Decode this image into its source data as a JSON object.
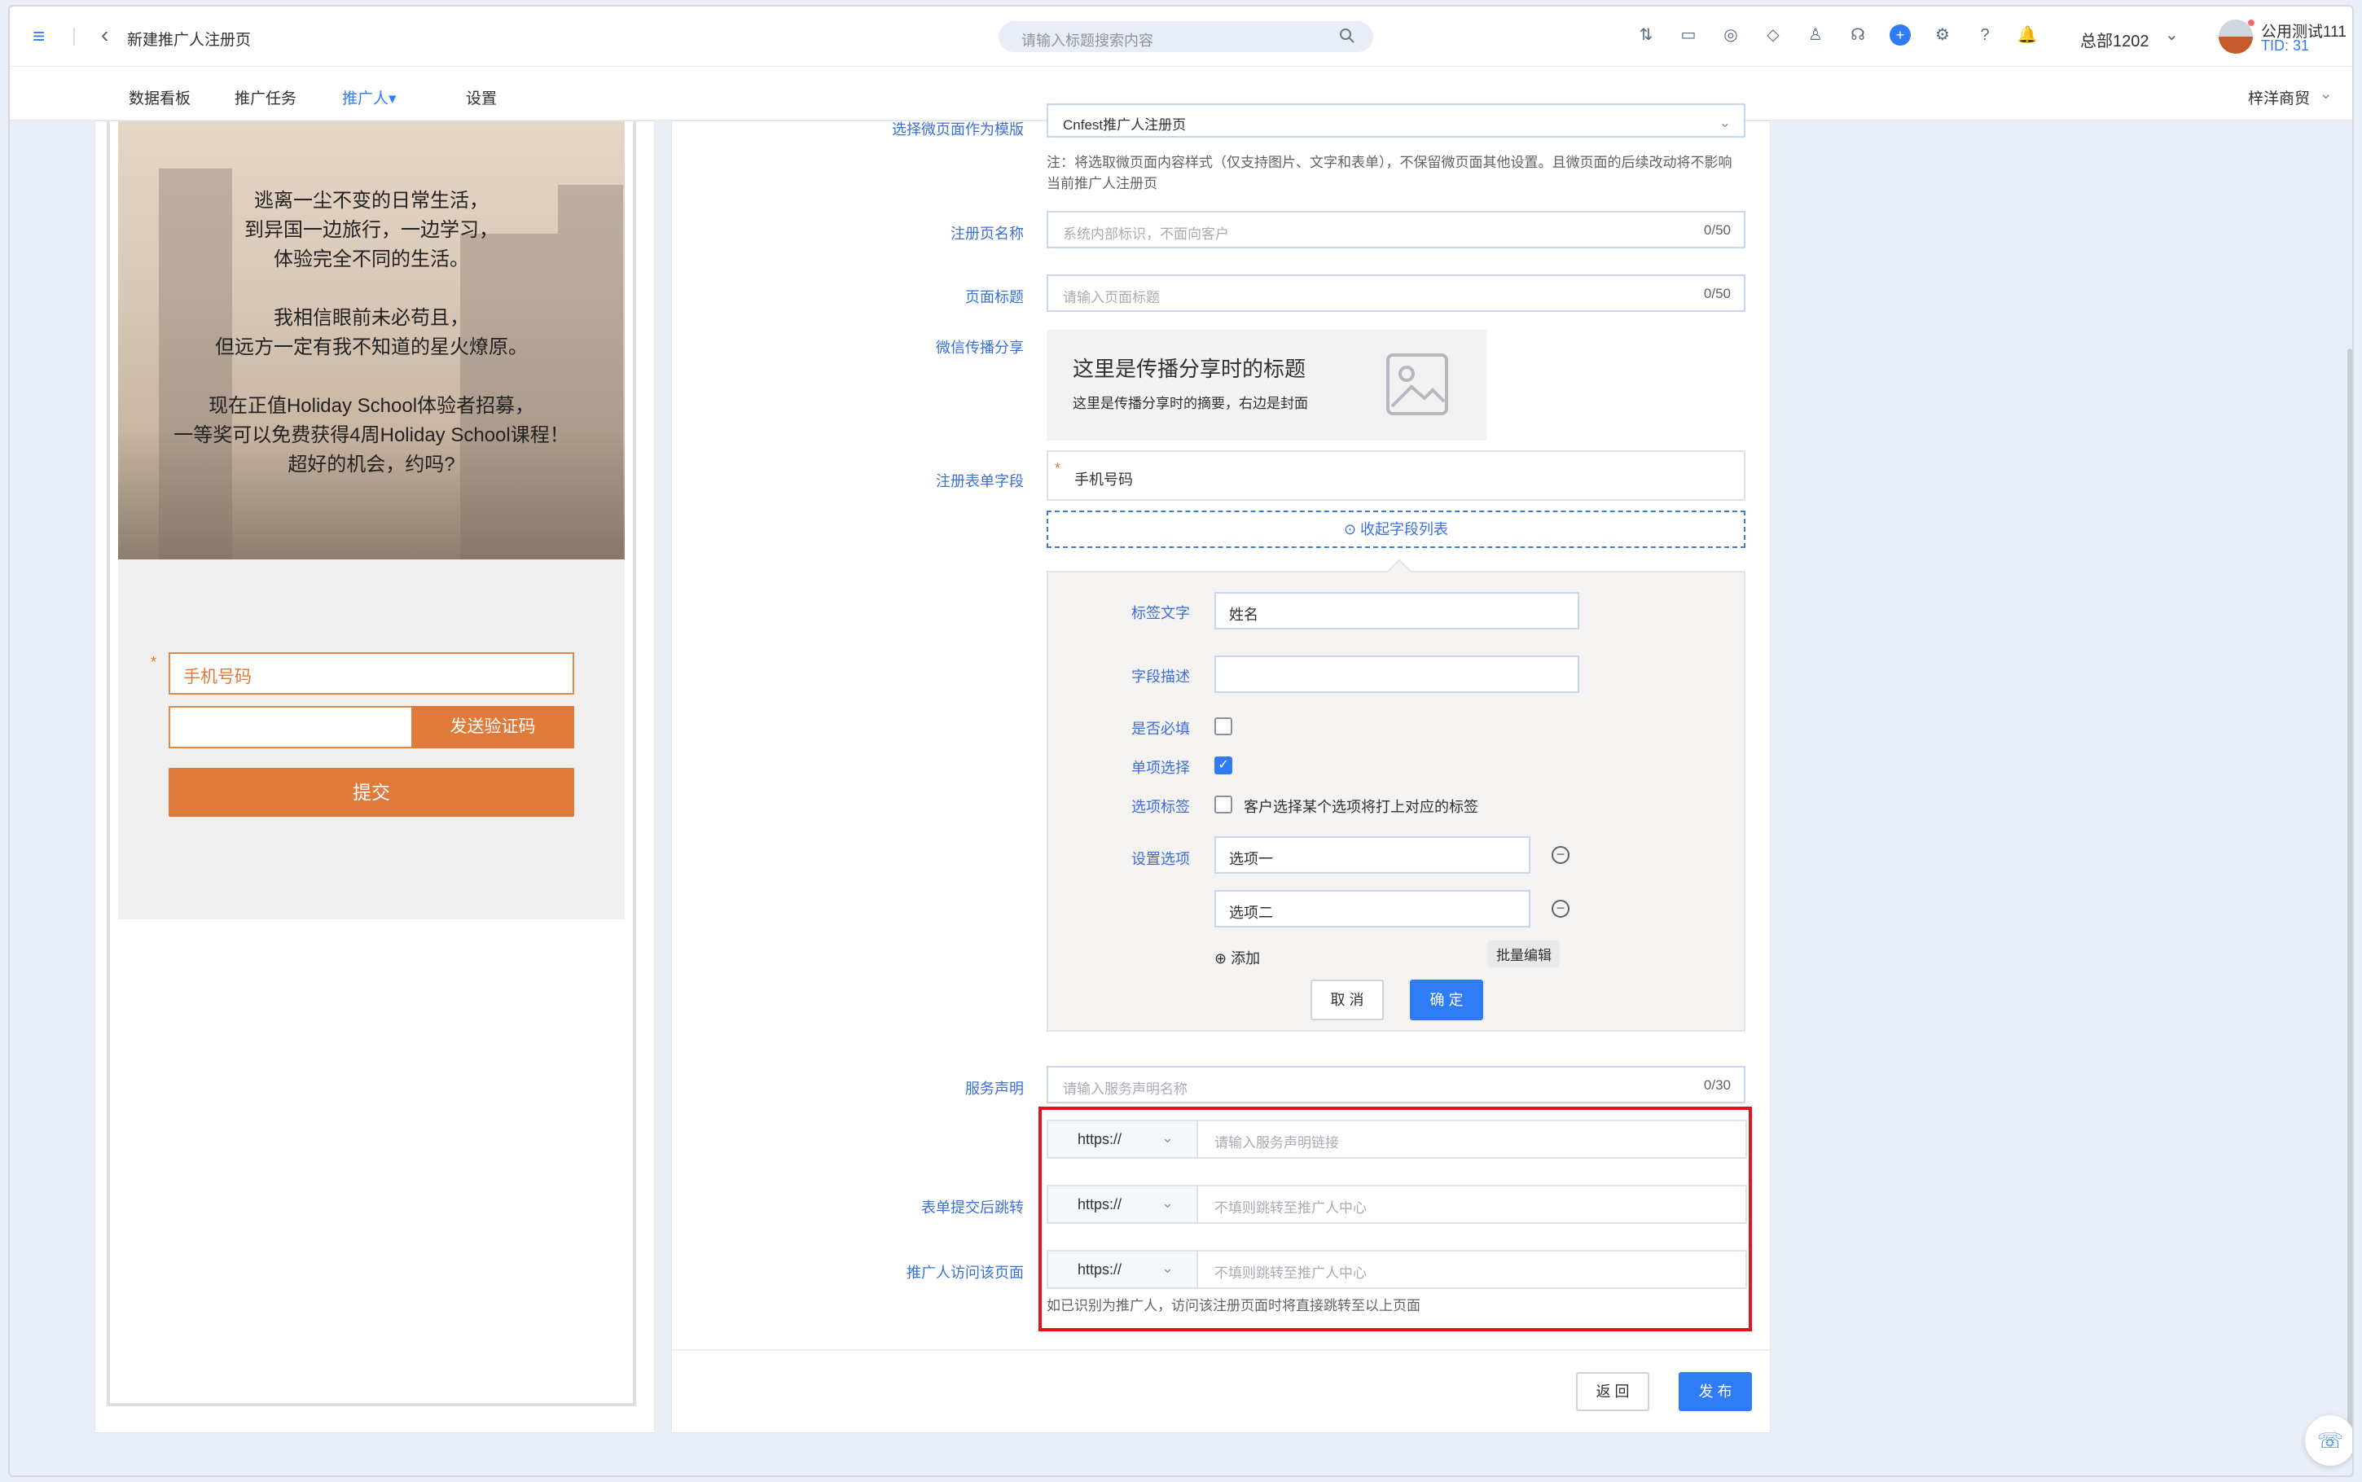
{
  "topbar": {
    "page_title": "新建推广人注册页",
    "search_placeholder": "请输入标题搜索内容",
    "org": "总部1202",
    "user_name": "公用测试111",
    "user_tid": "TID: 31"
  },
  "nav": {
    "items": [
      "数据看板",
      "推广任务",
      "推广人",
      "设置"
    ],
    "active_caret": "▾",
    "shop_name": "梓洋商贸"
  },
  "preview": {
    "hero_lines": [
      "逃离一尘不变的日常生活，",
      "到异国一边旅行，一边学习，",
      "体验完全不同的生活。",
      "我相信眼前未必苟且，",
      "但远方一定有我不知道的星火燎原。",
      "现在正值Holiday School体验者招募，",
      "一等奖可以免费获得4周Holiday School课程！",
      "超好的机会，约吗?"
    ],
    "phone_field": "手机号码",
    "send_code": "发送验证码",
    "submit": "提交",
    "required_mark": "*"
  },
  "form": {
    "template_label": "选择微页面作为模版",
    "template_value": "Cnfest推广人注册页",
    "template_note": "注：将选取微页面内容样式（仅支持图片、文字和表单），不保留微页面其他设置。且微页面的后续改动将不影响当前推广人注册页",
    "name_label": "注册页名称",
    "name_placeholder": "系统内部标识，不面向客户",
    "name_count": "0/50",
    "title_label": "页面标题",
    "title_placeholder": "请输入页面标题",
    "title_count": "0/50",
    "share_label": "微信传播分享",
    "share_title": "这里是传播分享时的标题",
    "share_desc": "这里是传播分享时的摘要，右边是封面",
    "fields_label": "注册表单字段",
    "required_mark": "*",
    "field_phone": "手机号码",
    "collapse_text": "收起字段列表",
    "editor": {
      "tag_label": "标签文字",
      "tag_value": "姓名",
      "desc_label": "字段描述",
      "desc_value": "",
      "required_label": "是否必填",
      "single_label": "单项选择",
      "option_tag_label": "选项标签",
      "option_tag_text": "客户选择某个选项将打上对应的标签",
      "options_label": "设置选项",
      "options": [
        "选项一",
        "选项二"
      ],
      "add": "添加",
      "batch_edit": "批量编辑",
      "cancel": "取 消",
      "confirm": "确 定"
    },
    "service_label": "服务声明",
    "service_placeholder": "请输入服务声明名称",
    "service_count": "0/30",
    "protocol": "https://",
    "service_link_placeholder": "请输入服务声明链接",
    "redirect_label": "表单提交后跳转",
    "redirect_placeholder": "不填则跳转至推广人中心",
    "visit_label": "推广人访问该页面",
    "visit_placeholder": "不填则跳转至推广人中心",
    "visit_note": "如已识别为推广人，访问该注册页面时将直接跳转至以上页面",
    "back": "返 回",
    "publish": "发 布"
  },
  "colors": {
    "accent": "#2f7cf6",
    "brand_orange": "#e07a3a",
    "highlight_red": "#e2141f"
  }
}
